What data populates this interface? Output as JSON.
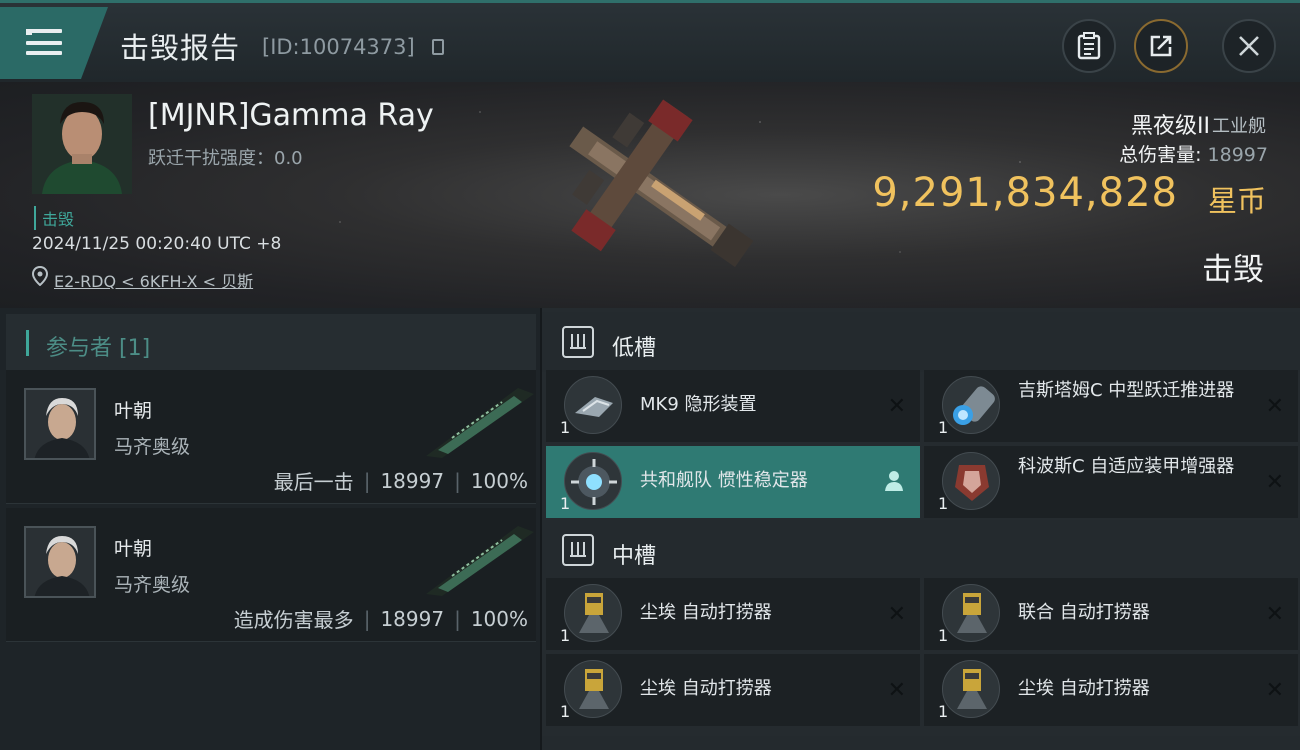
{
  "header": {
    "title": "击毁报告",
    "id_text": "[ID:10074373]"
  },
  "victim": {
    "pilot_name": "[MJNR]Gamma Ray",
    "warp_label": "跃迁干扰强度：0.0",
    "status_tag": "击毁",
    "time": "2024/11/25 00:20:40 UTC +8",
    "location": "E2-RDQ < 6KFH-X < 贝斯",
    "ship_name": "黑夜级II",
    "ship_class": "工业舰",
    "total_damage_label": "总伤害量:",
    "total_damage": "18997",
    "isk_value": "9,291,834,828",
    "isk_unit": "星币",
    "result": "击毁"
  },
  "participants": {
    "title": "参与者 [1]",
    "items": [
      {
        "name": "叶朝",
        "ship": "马齐奥级",
        "role": "最后一击",
        "damage": "18997",
        "percent": "100%"
      },
      {
        "name": "叶朝",
        "ship": "马齐奥级",
        "role": "造成伤害最多",
        "damage": "18997",
        "percent": "100%"
      }
    ]
  },
  "fitting": {
    "low_slots": {
      "label": "低槽",
      "modules": [
        {
          "name": "MK9 隐形装置",
          "qty": "1",
          "icon": "cloak-icon"
        },
        {
          "name": "吉斯塔姆C 中型跃迁推进器",
          "qty": "1",
          "icon": "mwd-icon"
        },
        {
          "name": "共和舰队 惯性稳定器",
          "qty": "1",
          "icon": "stabilizer-icon"
        },
        {
          "name": "科波斯C 自适应装甲增强器",
          "qty": "1",
          "icon": "armor-icon"
        }
      ]
    },
    "mid_slots": {
      "label": "中槽",
      "modules": [
        {
          "name": "尘埃 自动打捞器",
          "qty": "1",
          "icon": "salvager-icon"
        },
        {
          "name": "联合 自动打捞器",
          "qty": "1",
          "icon": "salvager-icon"
        },
        {
          "name": "尘埃 自动打捞器",
          "qty": "1",
          "icon": "salvager-icon"
        },
        {
          "name": "尘埃 自动打捞器",
          "qty": "1",
          "icon": "salvager-icon"
        }
      ]
    }
  },
  "colors": {
    "accent": "#2f7a73",
    "gold": "#f0c25e"
  }
}
